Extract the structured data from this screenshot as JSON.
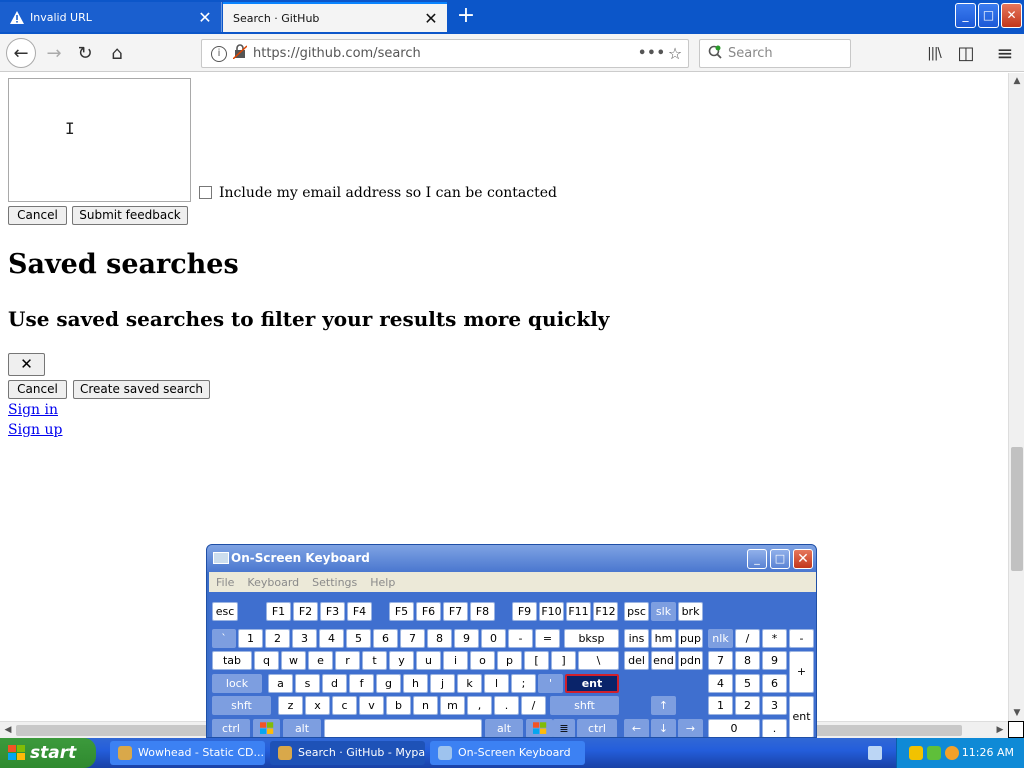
{
  "browser": {
    "tabs": [
      {
        "title": "Invalid URL",
        "close": "✕"
      },
      {
        "title": "Search · GitHub",
        "close": "✕"
      }
    ],
    "new_tab": "+",
    "window_buttons": {
      "minimize": "_",
      "maximize": "□",
      "close": "✕"
    },
    "nav": {
      "back": "←",
      "forward": "→",
      "reload": "↻",
      "home": "⌂",
      "info": "i"
    },
    "url": "https://github.com/search",
    "page_actions": "•••",
    "bookmark_star": "☆",
    "search_placeholder": "Search",
    "toolbar_icons": {
      "library": "|||\\",
      "sidebar": "◫",
      "menu": "≡"
    }
  },
  "page": {
    "text_cursor": "I",
    "include_email_label": "Include my email address so I can be contacted",
    "feedback_cancel": "Cancel",
    "feedback_submit": "Submit feedback",
    "saved_heading": "Saved searches",
    "saved_subheading": "Use saved searches to filter your results more quickly",
    "close_button": "✕",
    "saved_cancel": "Cancel",
    "create_saved": "Create saved search",
    "sign_in": "Sign in",
    "sign_up": "Sign up"
  },
  "osk": {
    "title": "On-Screen Keyboard",
    "menu": [
      "File",
      "Keyboard",
      "Settings",
      "Help"
    ],
    "rows": {
      "r1": [
        "esc",
        "F1",
        "F2",
        "F3",
        "F4",
        "F5",
        "F6",
        "F7",
        "F8",
        "F9",
        "F10",
        "F11",
        "F12",
        "psc",
        "slk",
        "brk"
      ],
      "r2": [
        "`",
        "1",
        "2",
        "3",
        "4",
        "5",
        "6",
        "7",
        "8",
        "9",
        "0",
        "-",
        "=",
        "bksp",
        "ins",
        "hm",
        "pup",
        "nlk",
        "/",
        "*",
        "-"
      ],
      "r3": [
        "tab",
        "q",
        "w",
        "e",
        "r",
        "t",
        "y",
        "u",
        "i",
        "o",
        "p",
        "[",
        "]",
        "\\",
        "del",
        "end",
        "pdn",
        "7",
        "8",
        "9",
        "+"
      ],
      "r4": [
        "lock",
        "a",
        "s",
        "d",
        "f",
        "g",
        "h",
        "j",
        "k",
        "l",
        ";",
        "'",
        "ent",
        "4",
        "5",
        "6"
      ],
      "r5": [
        "shft",
        "z",
        "x",
        "c",
        "v",
        "b",
        "n",
        "m",
        ",",
        ".",
        "/",
        "shft",
        "↑",
        "1",
        "2",
        "3",
        "ent"
      ],
      "r6": [
        "ctrl",
        "alt",
        "",
        "alt",
        "ctrl",
        "←",
        "↓",
        "→",
        "0",
        "."
      ]
    }
  },
  "taskbar": {
    "start": "start",
    "items": [
      "Wowhead - Static CD...",
      "Search · GitHub - Mypal",
      "On-Screen Keyboard"
    ],
    "clock": "11:26 AM"
  }
}
